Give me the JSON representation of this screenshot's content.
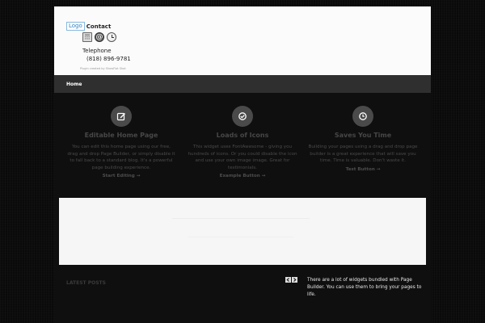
{
  "header": {
    "logo_text": "Logo",
    "contact_title": "Contact",
    "icons": [
      "calculator-icon",
      "at-sign-icon",
      "clock-icon"
    ],
    "telephone_label": "Telephone",
    "telephone_number": "(818) 896-9781",
    "plugin_credit": "Plugin created by ShowFlat Shot"
  },
  "nav": {
    "items": [
      {
        "label": "Home"
      }
    ]
  },
  "features": [
    {
      "icon": "edit-icon",
      "title": "Editable Home Page",
      "text": "You can edit this home page using our free, drag and drop Page Builder, or simply disable it to fall back to a standard blog. It's a powerful page building experience.",
      "link": "Start Editing →"
    },
    {
      "icon": "check-circle-icon",
      "title": "Loads of Icons",
      "text": "This widget uses FontAwesome - giving you hundreds of icons. Or you could disable the icon and use your own image image. Great for testimonials.",
      "link": "Example Button →"
    },
    {
      "icon": "clock-icon",
      "title": "Saves You Time",
      "text": "Building your pages using a drag and drop page builder is a great experience that will save you time. Time is valuable. Don't waste it.",
      "link": "Test Button →"
    }
  ],
  "latest_posts": {
    "title": "LATEST POSTS",
    "prev_label": "‹",
    "next_label": "›"
  },
  "widgets_text": "There are a lot of widgets bundled with Page Builder. You can use them to bring your pages to life.",
  "colors": {
    "page_bg": "#0a0a0a",
    "header_bg": "#fbfbfb",
    "nav_bg": "#2f2f2f",
    "feature_icon_bg": "#4a4a4a",
    "banner_bg": "#f6f6f6"
  }
}
